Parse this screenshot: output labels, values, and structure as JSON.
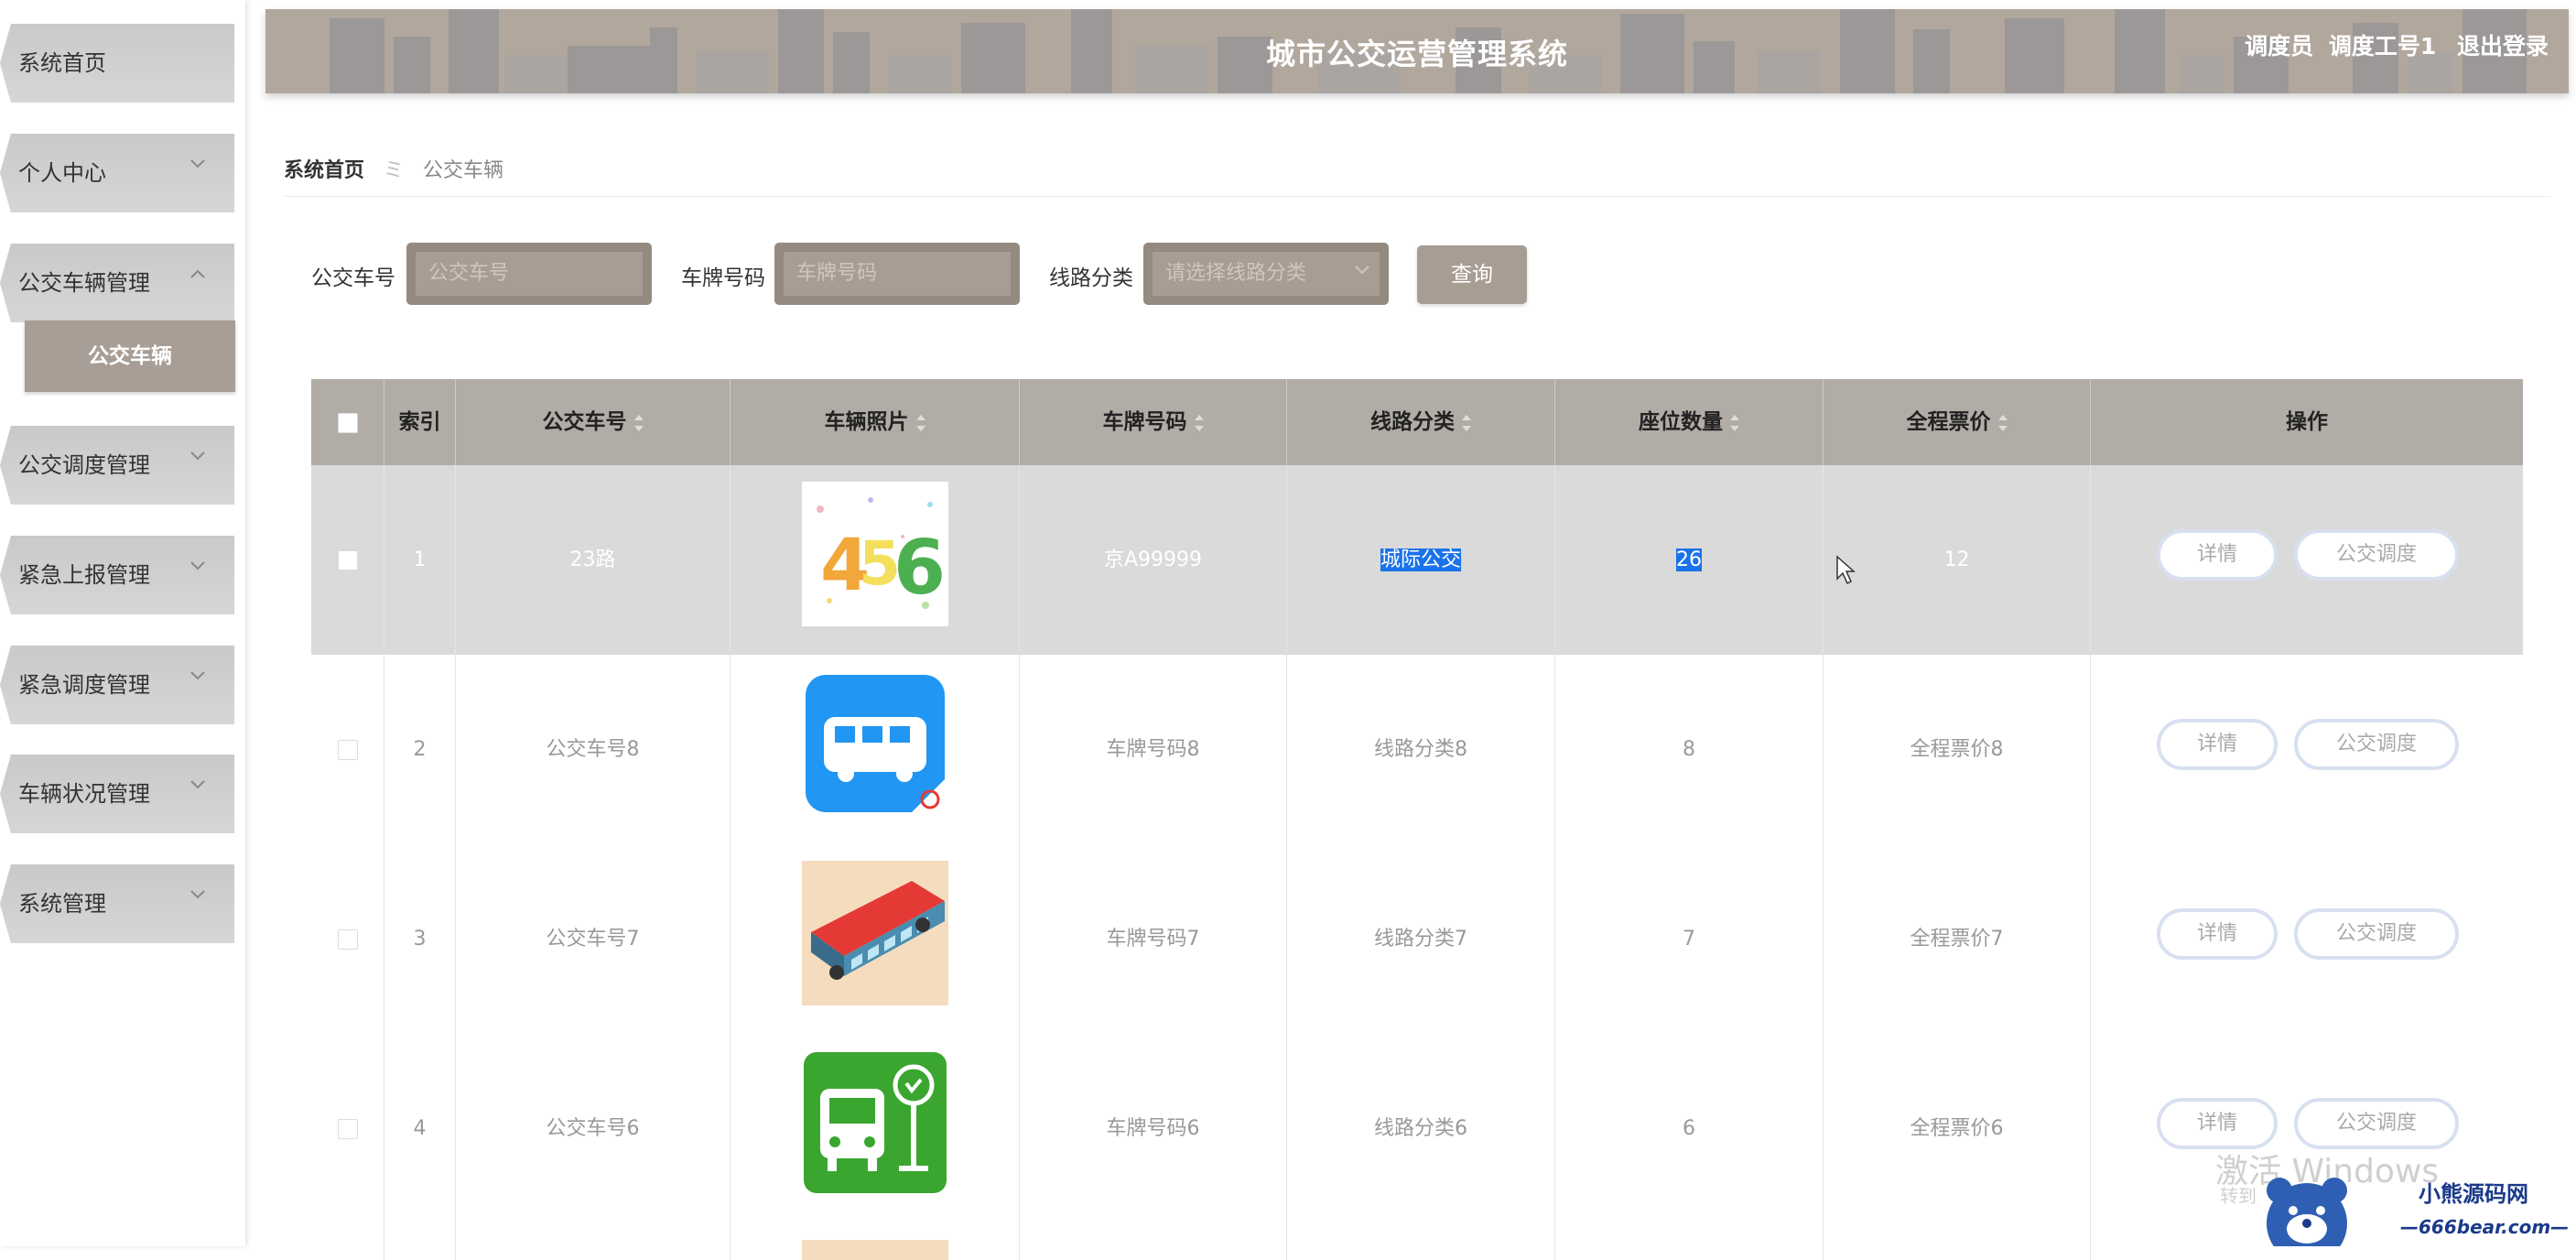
{
  "app": {
    "title": "城市公交运营管理系统",
    "user_role": "调度员",
    "user_name": "调度工号1",
    "logout": "退出登录"
  },
  "sidebar": {
    "items": [
      {
        "label": "系统首页",
        "expanded": null
      },
      {
        "label": "个人中心",
        "expanded": false
      },
      {
        "label": "公交车辆管理",
        "expanded": true
      },
      {
        "label": "公交调度管理",
        "expanded": false
      },
      {
        "label": "紧急上报管理",
        "expanded": false
      },
      {
        "label": "紧急调度管理",
        "expanded": false
      },
      {
        "label": "车辆状况管理",
        "expanded": false
      },
      {
        "label": "系统管理",
        "expanded": false
      }
    ],
    "active_sub": "公交车辆"
  },
  "breadcrumb": {
    "home": "系统首页",
    "current": "公交车辆"
  },
  "search": {
    "bus_no_label": "公交车号",
    "bus_no_placeholder": "公交车号",
    "plate_label": "车牌号码",
    "plate_placeholder": "车牌号码",
    "route_label": "线路分类",
    "route_placeholder": "请选择线路分类",
    "query_button": "查询"
  },
  "table": {
    "headers": {
      "index": "索引",
      "bus_no": "公交车号",
      "photo": "车辆照片",
      "plate": "车牌号码",
      "route": "线路分类",
      "seats": "座位数量",
      "fare": "全程票价",
      "ops": "操作"
    },
    "rows": [
      {
        "index": "1",
        "bus_no": "23路",
        "photo": "numbers-456",
        "plate": "京A99999",
        "route": "城际公交",
        "seats": "26",
        "fare": "12"
      },
      {
        "index": "2",
        "bus_no": "公交车号8",
        "photo": "bus-app-icon",
        "plate": "车牌号码8",
        "route": "线路分类8",
        "seats": "8",
        "fare": "全程票价8"
      },
      {
        "index": "3",
        "bus_no": "公交车号7",
        "photo": "red-bus-illustration",
        "plate": "车牌号码7",
        "route": "线路分类7",
        "seats": "7",
        "fare": "全程票价7"
      },
      {
        "index": "4",
        "bus_no": "公交车号6",
        "photo": "bus-stop-icon",
        "plate": "车牌号码6",
        "route": "线路分类6",
        "seats": "6",
        "fare": "全程票价6"
      }
    ],
    "detail_button": "详情",
    "dispatch_button": "公交调度"
  },
  "watermark": {
    "line1": "激活 Windows",
    "line2": "转到",
    "logo_title": "小熊源码网",
    "logo_url": "—666bear.com—"
  },
  "colors": {
    "accent": "#a89d93",
    "header": "#b2a79d",
    "selection": "#1a73e8"
  }
}
